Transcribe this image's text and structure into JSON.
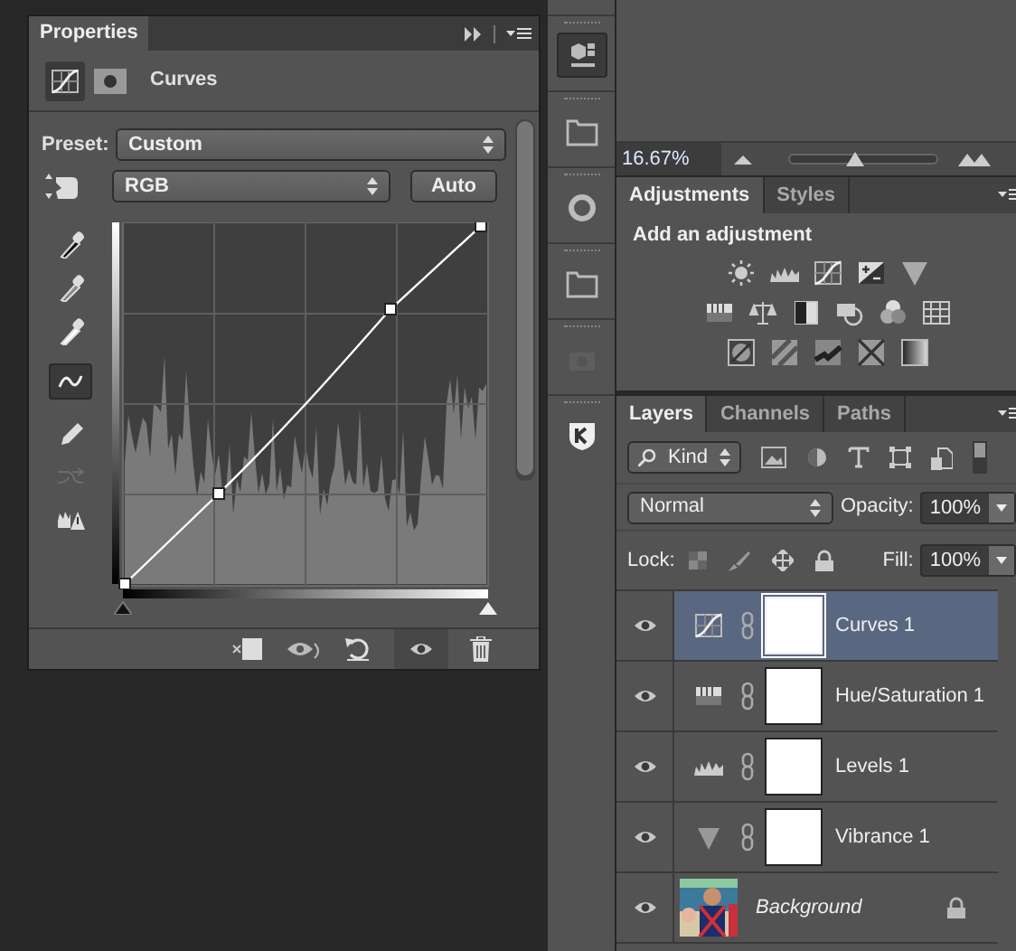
{
  "properties": {
    "tab": {
      "label": "Properties",
      "selected": true
    },
    "title": "Curves",
    "preset_label": "Preset:",
    "preset": "Custom",
    "channel": "RGB",
    "auto_button": "Auto",
    "input_sliders": [
      {
        "level": 0
      },
      {
        "level": 1
      }
    ],
    "tools": [
      {
        "selected": false,
        "disabled": false
      },
      {
        "selected": false,
        "disabled": false
      },
      {
        "selected": false,
        "disabled": false
      },
      {
        "selected": true,
        "disabled": false
      },
      {
        "selected": false,
        "disabled": false
      },
      {
        "selected": false,
        "disabled": true
      },
      {
        "selected": false,
        "disabled": false
      }
    ]
  },
  "dock": [
    {
      "selected": true,
      "disabled": false
    },
    {
      "selected": false,
      "disabled": false
    },
    {
      "selected": false,
      "disabled": false
    },
    {
      "selected": false,
      "disabled": false
    },
    {
      "selected": false,
      "disabled": true
    },
    {
      "selected": false,
      "disabled": false
    }
  ],
  "zoom": {
    "value": "16.67%",
    "level": 0.45
  },
  "adjustments": {
    "tabs": [
      {
        "label": "Adjustments",
        "selected": true
      },
      {
        "label": "Styles",
        "selected": false
      }
    ],
    "heading": "Add an adjustment"
  },
  "layers_panel": {
    "tabs": [
      {
        "label": "Layers",
        "selected": true
      },
      {
        "label": "Channels",
        "selected": false
      },
      {
        "label": "Paths",
        "selected": false
      }
    ],
    "filter": "Kind",
    "blend_mode": "Normal",
    "opacity_label": "Opacity:",
    "opacity": "100%",
    "lock_label": "Lock:",
    "fill_label": "Fill:",
    "fill": "100%",
    "layers": [
      {
        "name": "Curves 1",
        "kind": "curves",
        "selected": true,
        "visible": true,
        "locked": false
      },
      {
        "name": "Hue/Saturation 1",
        "kind": "hue",
        "selected": false,
        "visible": true,
        "locked": false
      },
      {
        "name": "Levels 1",
        "kind": "levels",
        "selected": false,
        "visible": true,
        "locked": false
      },
      {
        "name": "Vibrance 1",
        "kind": "vibrance",
        "selected": false,
        "visible": true,
        "locked": false
      },
      {
        "name": "Background",
        "kind": "picture",
        "selected": false,
        "visible": true,
        "locked": true
      }
    ]
  }
}
